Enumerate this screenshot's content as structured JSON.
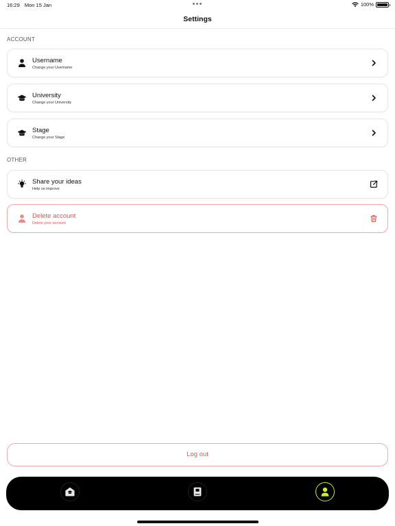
{
  "status_bar": {
    "time": "16:29",
    "date": "Mon 15 Jan",
    "battery": "100%"
  },
  "header": {
    "title": "Settings"
  },
  "sections": {
    "account": {
      "title": "ACCOUNT",
      "items": [
        {
          "label": "Username",
          "sub": "Change your Username",
          "icon": "person-icon",
          "trail_icon": "chevron-right-icon"
        },
        {
          "label": "University",
          "sub": "Change your University",
          "icon": "graduation-cap-icon",
          "trail_icon": "chevron-right-icon"
        },
        {
          "label": "Stage",
          "sub": "Change your Stage",
          "icon": "graduation-cap-icon",
          "trail_icon": "chevron-right-icon"
        }
      ]
    },
    "other": {
      "title": "OTHER",
      "items": [
        {
          "label": "Share your ideas",
          "sub": "Help us improve",
          "icon": "lightbulb-icon",
          "trail_icon": "external-link-icon"
        },
        {
          "label": "Delete account",
          "sub": "Delete your account",
          "icon": "person-icon",
          "trail_icon": "trash-icon"
        }
      ]
    }
  },
  "logout": {
    "label": "Log out"
  },
  "tab_bar": {
    "tabs": [
      {
        "name": "home",
        "icon": "home-icon",
        "active": false
      },
      {
        "name": "book",
        "icon": "book-icon",
        "active": false
      },
      {
        "name": "profile",
        "icon": "person-icon",
        "active": true
      }
    ]
  },
  "colors": {
    "danger": "#e0514f",
    "danger_border": "#f0a8a8",
    "accent": "#c8ec2e",
    "tab_bar_bg": "#000000"
  }
}
